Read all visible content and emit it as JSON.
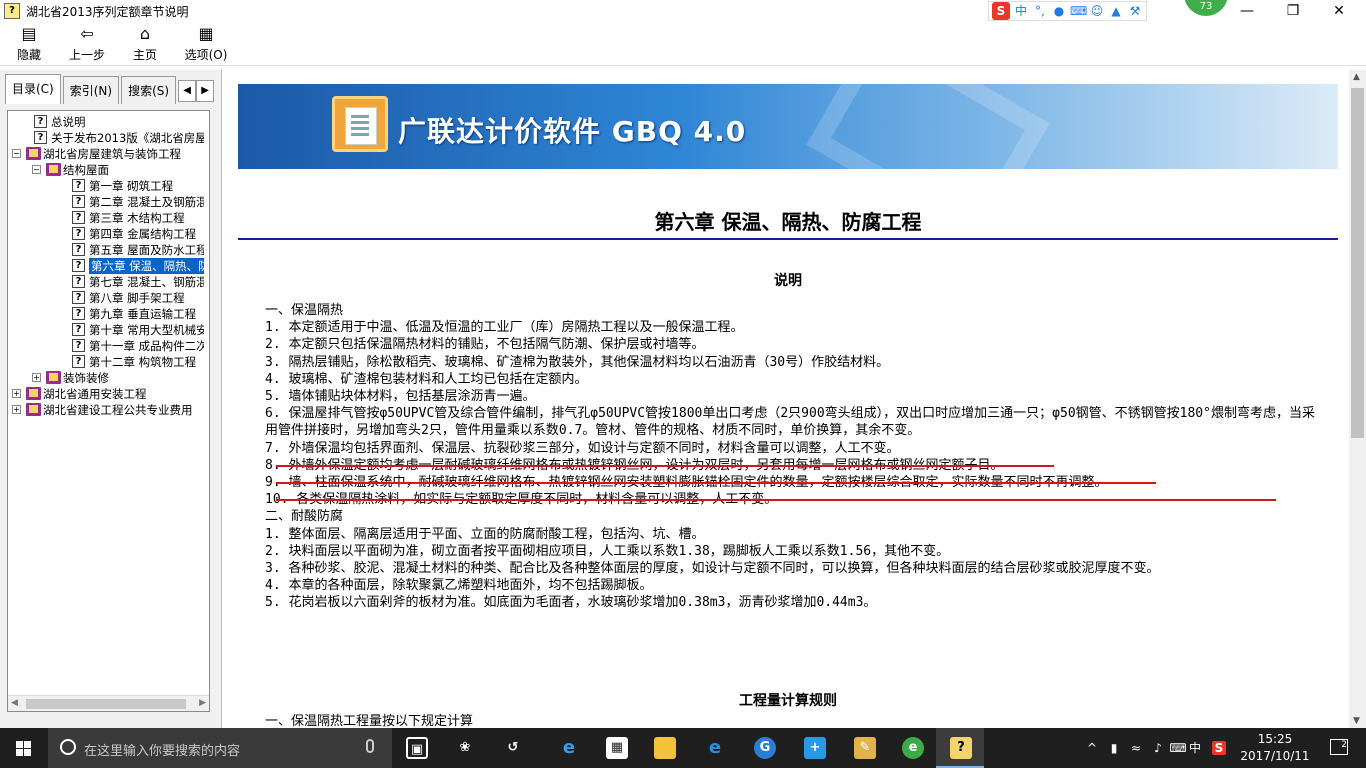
{
  "window": {
    "title": "湖北省2013序列定额章节说明",
    "minimize": "—",
    "restore": "❐",
    "close": "✕",
    "notification_badge": "73"
  },
  "ime": {
    "logo": "S",
    "mode": "中",
    "punct": "°,",
    "icons": [
      "microphone-icon",
      "keyboard-icon",
      "user-icon",
      "shirt-icon",
      "wrench-icon"
    ]
  },
  "toolbar": {
    "hide_label": "隐藏",
    "back_label": "上一步",
    "home_label": "主页",
    "options_label": "选项(O)"
  },
  "tabs": {
    "contents": "目录(C)",
    "index": "索引(N)",
    "search": "搜索(S)"
  },
  "tree": {
    "items": [
      {
        "level": 1,
        "type": "page",
        "text": "总说明"
      },
      {
        "level": 1,
        "type": "page",
        "text": "关于发布2013版《湖北省房屋"
      },
      {
        "level": 0,
        "type": "book",
        "exp": "−",
        "text": "湖北省房屋建筑与装饰工程"
      },
      {
        "level": 1,
        "type": "book",
        "exp": "−",
        "text": "结构屋面"
      },
      {
        "level": 2,
        "type": "page",
        "text": "第一章  砌筑工程"
      },
      {
        "level": 2,
        "type": "page",
        "text": "第二章  混凝土及钢筋混"
      },
      {
        "level": 2,
        "type": "page",
        "text": "第三章  木结构工程"
      },
      {
        "level": 2,
        "type": "page",
        "text": "第四章  金属结构工程"
      },
      {
        "level": 2,
        "type": "page",
        "text": "第五章  屋面及防水工程"
      },
      {
        "level": 2,
        "type": "page",
        "text": "第六章  保温、隔热、防",
        "selected": true
      },
      {
        "level": 2,
        "type": "page",
        "text": "第七章  混凝土、钢筋混"
      },
      {
        "level": 2,
        "type": "page",
        "text": "第八章  脚手架工程"
      },
      {
        "level": 2,
        "type": "page",
        "text": "第九章  垂直运输工程"
      },
      {
        "level": 2,
        "type": "page",
        "text": "第十章  常用大型机械安"
      },
      {
        "level": 2,
        "type": "page",
        "text": "第十一章  成品构件二次"
      },
      {
        "level": 2,
        "type": "page",
        "text": "第十二章  构筑物工程"
      },
      {
        "level": 1,
        "type": "book",
        "exp": "+",
        "text": "装饰装修"
      },
      {
        "level": 0,
        "type": "book",
        "exp": "+",
        "text": "湖北省通用安装工程"
      },
      {
        "level": 0,
        "type": "book",
        "exp": "+",
        "text": "湖北省建设工程公共专业费用"
      }
    ]
  },
  "banner": {
    "brand": "广联达计价软件 GBQ 4.0"
  },
  "doc": {
    "chapter_title": "第六章  保温、隔热、防腐工程",
    "section_title": "说明",
    "lines": [
      "一、保温隔热",
      "1. 本定额适用于中温、低温及恒温的工业厂（库）房隔热工程以及一般保温工程。",
      "2. 本定额只包括保温隔热材料的铺贴，不包括隔气防潮、保护层或衬墙等。",
      "3. 隔热层铺贴，除松散稻壳、玻璃棉、矿渣棉为散装外，其他保温材料均以石油沥青（30号）作胶结材料。",
      "4. 玻璃棉、矿渣棉包装材料和人工均已包括在定额内。",
      "5. 墙体铺贴块体材料，包括基层涂沥青一遍。",
      "6. 保温屋排气管按φ50UPVC管及综合管件编制，排气孔φ50UPVC管按1800单出口考虑（2只900弯头组成），双出口时应增加三通一只；φ50钢管、不锈钢管按180°煨制弯考虑，当采用管件拼接时，另增加弯头2只，管件用量乘以系数0.7。管材、管件的规格、材质不同时，单价换算，其余不变。",
      "7. 外墙保温均包括界面剂、保温层、抗裂砂浆三部分，如设计与定额不同时，材料含量可以调整，人工不变。",
      "8. 外墙外保温定额均考虑一层耐碱玻璃纤维网格布或热镀锌钢丝网，设计为双层时，另套用每增一层网格布或钢丝网定额子目。",
      "9. 墙、柱面保温系统中，耐碱玻璃纤维网格布、热镀锌钢丝网安装塑料膨胀锚栓固定件的数量，定额按楼层综合取定，实际数量不同时不再调整。",
      "10. 各类保温隔热涂料，如实际与定额取定厚度不同时，材料含量可以调整，人工不变。",
      "二、耐酸防腐",
      "1. 整体面层、隔离层适用于平面、立面的防腐耐酸工程，包括沟、坑、槽。",
      "2. 块料面层以平面砌为准，砌立面者按平面砌相应项目，人工乘以系数1.38，踢脚板人工乘以系数1.56，其他不变。",
      "3. 各种砂浆、胶泥、混凝土材料的种类、配合比及各种整体面层的厚度，如设计与定额不同时，可以换算，但各种块料面层的结合层砂浆或胶泥厚度不变。",
      "4. 本章的各种面层，除软聚氯乙烯塑料地面外，均不包括踢脚板。",
      "5. 花岗岩板以六面剁斧的板材为准。如底面为毛面者，水玻璃砂浆增加0.38m3，沥青砂浆增加0.44m3。"
    ],
    "calc_title": "工程量计算规则",
    "calc_first_line": "一、保温隔热工程量按以下规定计算"
  },
  "taskbar": {
    "search_placeholder": "在这里输入你要搜索的内容",
    "ime_mode": "中",
    "ime_logo": "S",
    "time": "15:25",
    "date": "2017/10/11",
    "notifications": "2"
  },
  "colors": {
    "selection": "#0a64c8",
    "rule": "#1a1aa0",
    "annotation_red": "#d01a1a",
    "taskbar": "#1f1f1f"
  }
}
